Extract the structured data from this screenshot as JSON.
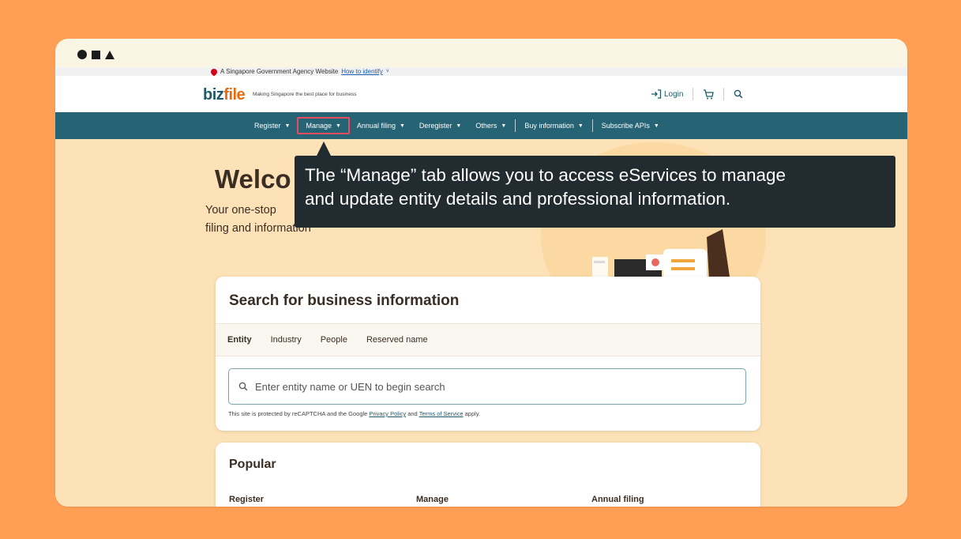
{
  "gov_bar": {
    "text": "A Singapore Government Agency Website",
    "link": "How to identify",
    "chevron": "˅"
  },
  "header": {
    "logo_prefix": "biz",
    "logo_suffix": "file",
    "tagline": "Making Singapore the best place for business",
    "login_label": "Login",
    "icons": [
      "login-icon",
      "cart-icon",
      "search-icon"
    ]
  },
  "nav": {
    "items": [
      {
        "label": "Register"
      },
      {
        "label": "Manage"
      },
      {
        "label": "Annual filing"
      },
      {
        "label": "Deregister"
      },
      {
        "label": "Others"
      },
      {
        "label": "Buy information"
      },
      {
        "label": "Subscribe APIs"
      }
    ],
    "caret": "▼"
  },
  "hero": {
    "title": "Welco",
    "subtitle_1": "Your one-stop",
    "subtitle_2": "filing and information"
  },
  "tooltip": {
    "line1": "The “Manage” tab allows you to access eServices to manage",
    "line2": "and update entity details and professional information."
  },
  "search": {
    "title": "Search for business information",
    "tabs": [
      {
        "label": "Entity",
        "active": true
      },
      {
        "label": "Industry",
        "active": false
      },
      {
        "label": "People",
        "active": false
      },
      {
        "label": "Reserved name",
        "active": false
      }
    ],
    "placeholder": "Enter entity name or UEN to begin search",
    "recaptcha_prefix": "This site is protected by reCAPTCHA and the Google",
    "privacy_link": "Privacy Policy",
    "recaptcha_and": "and",
    "terms_link": "Terms of Service",
    "recaptcha_suffix": "apply."
  },
  "popular": {
    "title": "Popular",
    "columns": [
      "Register",
      "Manage",
      "Annual filing"
    ]
  },
  "colors": {
    "page_bg": "#ff9f55",
    "nav_bg": "#266374",
    "accent_orange": "#e86b0e",
    "tooltip_bg": "#222b2f",
    "highlight_border": "#e84a5f"
  }
}
